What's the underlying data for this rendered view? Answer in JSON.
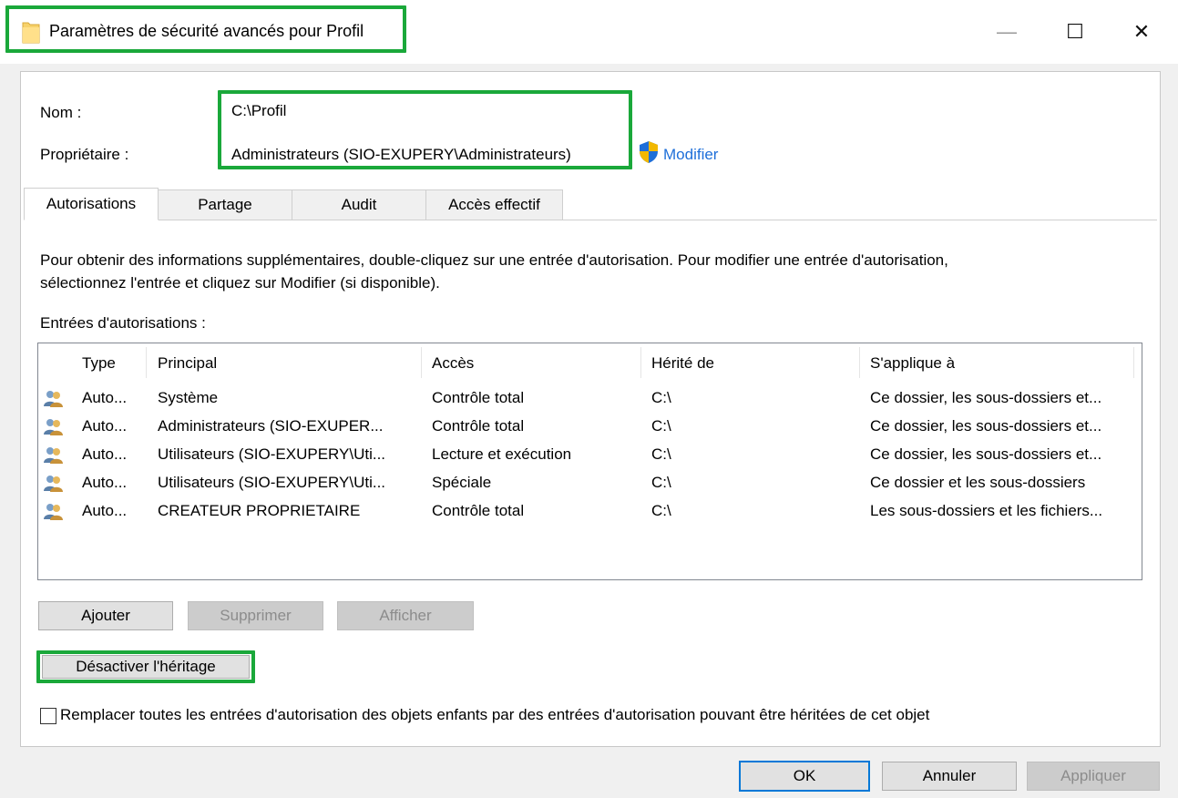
{
  "window": {
    "title": "Paramètres de sécurité avancés pour Profil",
    "icons": {
      "app": "folder-icon",
      "minimize": "minimize-icon",
      "maximize": "maximize-icon",
      "close": "close-icon"
    },
    "glyphs": {
      "minimize": "—",
      "maximize": "☐",
      "close": "✕"
    }
  },
  "info": {
    "name_label": "Nom :",
    "name_value": "C:\\Profil",
    "owner_label": "Propriétaire :",
    "owner_value": "Administrateurs (SIO-EXUPERY\\Administrateurs)",
    "change_link": "Modifier",
    "change_icon": "uac-shield-icon"
  },
  "tabs": [
    {
      "label": "Autorisations",
      "active": true
    },
    {
      "label": "Partage",
      "active": false
    },
    {
      "label": "Audit",
      "active": false
    },
    {
      "label": "Accès effectif",
      "active": false
    }
  ],
  "permissions": {
    "description_line1": "Pour obtenir des informations supplémentaires, double-cliquez sur une entrée d'autorisation. Pour modifier une entrée d'autorisation,",
    "description_line2": "sélectionnez l'entrée et cliquez sur Modifier (si disponible).",
    "entries_label": "Entrées d'autorisations :",
    "columns": [
      "Type",
      "Principal",
      "Accès",
      "Hérité de",
      "S'applique à"
    ],
    "rows": [
      {
        "icon": "users-icon",
        "type": "Auto...",
        "principal": "Système",
        "access": "Contrôle total",
        "inherited": "C:\\",
        "applies": "Ce dossier, les sous-dossiers et..."
      },
      {
        "icon": "users-icon",
        "type": "Auto...",
        "principal": "Administrateurs (SIO-EXUPER...",
        "access": "Contrôle total",
        "inherited": "C:\\",
        "applies": "Ce dossier, les sous-dossiers et..."
      },
      {
        "icon": "users-icon",
        "type": "Auto...",
        "principal": "Utilisateurs (SIO-EXUPERY\\Uti...",
        "access": "Lecture et exécution",
        "inherited": "C:\\",
        "applies": "Ce dossier, les sous-dossiers et..."
      },
      {
        "icon": "users-icon",
        "type": "Auto...",
        "principal": "Utilisateurs (SIO-EXUPERY\\Uti...",
        "access": "Spéciale",
        "inherited": "C:\\",
        "applies": "Ce dossier et les sous-dossiers"
      },
      {
        "icon": "users-icon",
        "type": "Auto...",
        "principal": "CREATEUR PROPRIETAIRE",
        "access": "Contrôle total",
        "inherited": "C:\\",
        "applies": "Les sous-dossiers et les fichiers..."
      }
    ],
    "buttons": {
      "add": "Ajouter",
      "remove": "Supprimer",
      "view": "Afficher"
    },
    "disable_inheritance": "Désactiver l'héritage",
    "replace_checkbox_label": "Remplacer toutes les entrées d'autorisation des objets enfants par des entrées d'autorisation pouvant être héritées de cet objet",
    "replace_checked": false
  },
  "footer": {
    "ok": "OK",
    "cancel": "Annuler",
    "apply": "Appliquer"
  },
  "colors": {
    "highlight": "#1aa83a",
    "link": "#1e6fd9",
    "default_button_border": "#0078d7"
  }
}
